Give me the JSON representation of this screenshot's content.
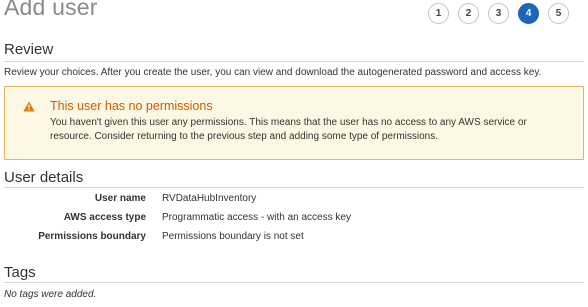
{
  "page": {
    "title": "Add user"
  },
  "steps": [
    {
      "label": "1",
      "active": false
    },
    {
      "label": "2",
      "active": false
    },
    {
      "label": "3",
      "active": false
    },
    {
      "label": "4",
      "active": true
    },
    {
      "label": "5",
      "active": false
    }
  ],
  "review": {
    "title": "Review",
    "description": "Review your choices. After you create the user, you can view and download the autogenerated password and access key."
  },
  "warning": {
    "icon": "warning-icon",
    "title": "This user has no permissions",
    "body": "You haven't given this user any permissions. This means that the user has no access to any AWS service or resource. Consider returning to the previous step and adding some type of permissions."
  },
  "user_details": {
    "title": "User details",
    "rows": [
      {
        "label": "User name",
        "value": "RVDataHubInventory"
      },
      {
        "label": "AWS access type",
        "value": "Programmatic access - with an access key"
      },
      {
        "label": "Permissions boundary",
        "value": "Permissions boundary is not set"
      }
    ]
  },
  "tags": {
    "title": "Tags",
    "empty_text": "No tags were added."
  },
  "colors": {
    "active_step": "#1b66b8",
    "warning_bg": "#fcf8e3",
    "warning_border": "#e4b659",
    "warning_title": "#d05a00"
  }
}
